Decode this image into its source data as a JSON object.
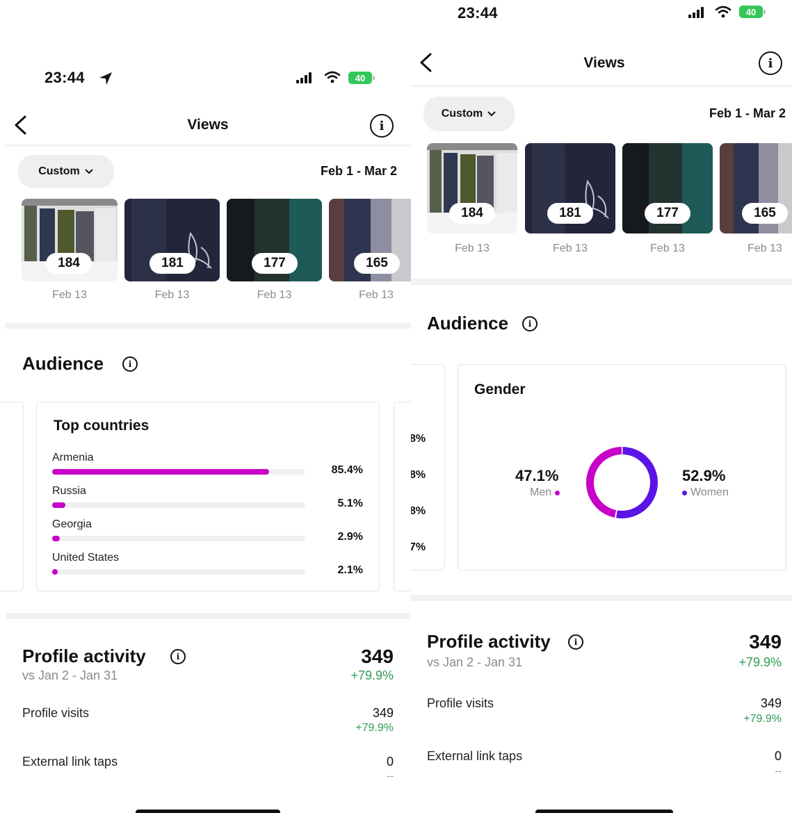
{
  "left": {
    "status": {
      "time": "23:44",
      "battery": "40"
    },
    "nav": {
      "title": "Views"
    },
    "filter": {
      "custom_label": "Custom",
      "date_range": "Feb 1 - Mar 2"
    },
    "thumbnails": [
      {
        "count": "184",
        "date": "Feb 13"
      },
      {
        "count": "181",
        "date": "Feb 13"
      },
      {
        "count": "177",
        "date": "Feb 13"
      },
      {
        "count": "165",
        "date": "Feb 13"
      }
    ],
    "audience": {
      "title": "Audience",
      "countries_title": "Top countries",
      "countries": [
        {
          "name": "Armenia",
          "percent": "85.4%",
          "value": 85.4
        },
        {
          "name": "Russia",
          "percent": "5.1%",
          "value": 5.1
        },
        {
          "name": "Georgia",
          "percent": "2.9%",
          "value": 2.9
        },
        {
          "name": "United States",
          "percent": "2.1%",
          "value": 2.1
        }
      ]
    },
    "profile": {
      "title": "Profile activity",
      "compare": "vs Jan 2 - Jan 31",
      "total": "349",
      "total_change": "+79.9%",
      "visits_label": "Profile visits",
      "visits_value": "349",
      "visits_change": "+79.9%",
      "link_label": "External link taps",
      "link_value": "0",
      "link_change": "--"
    }
  },
  "right": {
    "status": {
      "time": "23:44",
      "battery": "40"
    },
    "nav": {
      "title": "Views"
    },
    "filter": {
      "custom_label": "Custom",
      "date_range": "Feb 1 - Mar 2"
    },
    "thumbnails": [
      {
        "count": "184",
        "date": "Feb 13"
      },
      {
        "count": "181",
        "date": "Feb 13"
      },
      {
        "count": "177",
        "date": "Feb 13"
      },
      {
        "count": "165",
        "date": "Feb 13"
      }
    ],
    "audience": {
      "title": "Audience",
      "side_percents": [
        "8%",
        "8%",
        "8%",
        "7%"
      ],
      "gender_title": "Gender",
      "men_percent": "47.1%",
      "men_label": "Men",
      "women_percent": "52.9%",
      "women_label": "Women",
      "men_value": 47.1,
      "women_value": 52.9
    },
    "profile": {
      "title": "Profile activity",
      "compare": "vs Jan 2 - Jan 31",
      "total": "349",
      "total_change": "+79.9%",
      "visits_label": "Profile visits",
      "visits_value": "349",
      "visits_change": "+79.9%",
      "link_label": "External link taps",
      "link_value": "0",
      "link_change": "--"
    }
  },
  "colors": {
    "accent_magenta": "#c800c8",
    "women_purple": "#5b14e6",
    "positive_green": "#2e9b53",
    "battery_green": "#34c759"
  },
  "icons": [
    "location-arrow-icon",
    "signal-icon",
    "wifi-icon",
    "battery-icon",
    "back-chevron-icon",
    "info-icon",
    "chevron-down-icon"
  ]
}
